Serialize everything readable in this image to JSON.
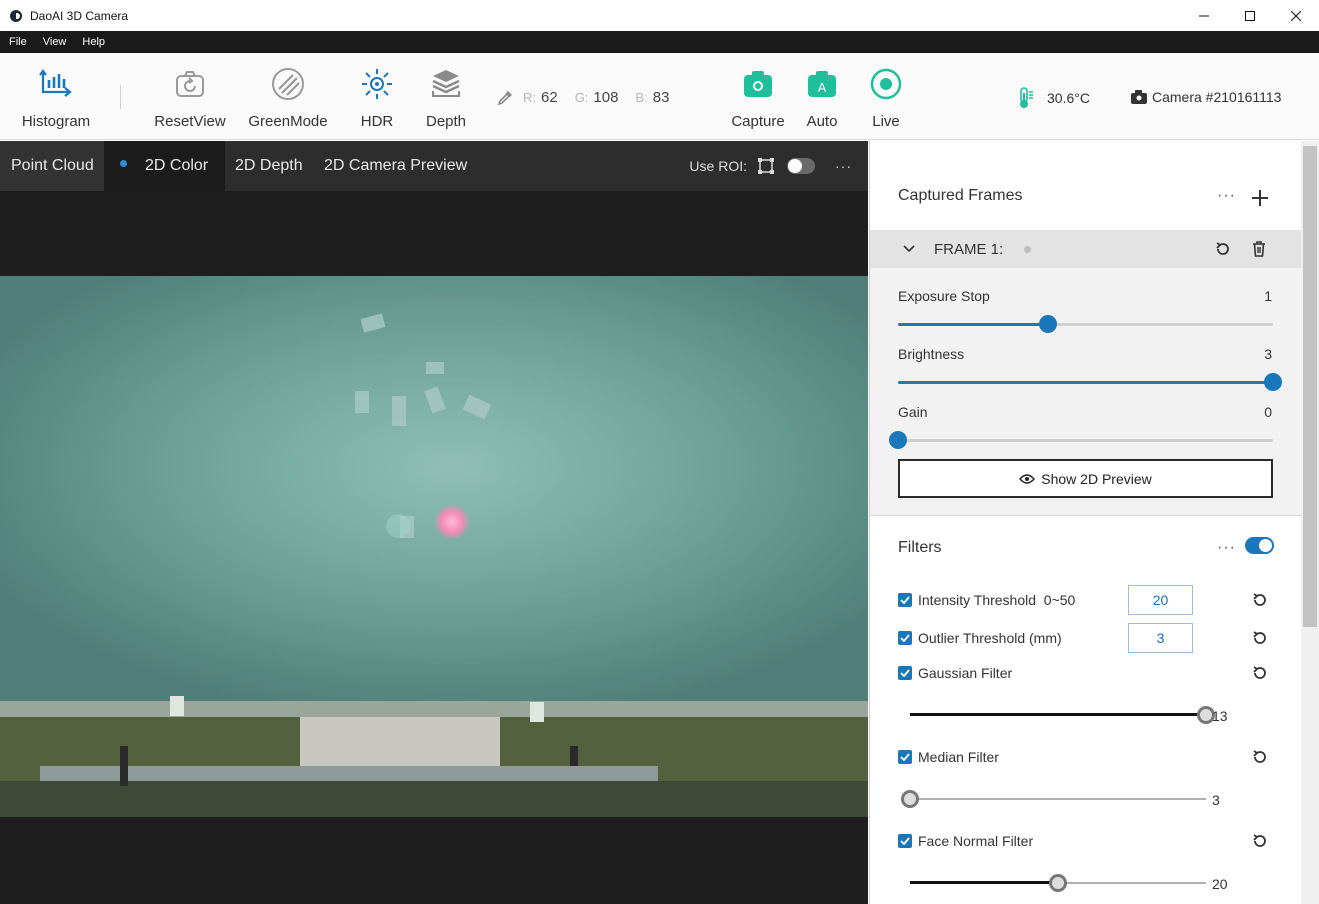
{
  "window": {
    "title": "DaoAI 3D Camera"
  },
  "menu": [
    "File",
    "View",
    "Help"
  ],
  "toolbar": {
    "histogram": "Histogram",
    "reset_view": "ResetView",
    "green_mode": "GreenMode",
    "hdr": "HDR",
    "depth": "Depth",
    "capture": "Capture",
    "auto": "Auto",
    "live": "Live",
    "rgb": {
      "r_label": "R:",
      "r": "62",
      "g_label": "G:",
      "g": "108",
      "b_label": "B:",
      "b": "83"
    },
    "temperature": "30.6°C",
    "camera": "Camera #210161113",
    "accent": "#1fbf9c"
  },
  "viewer": {
    "tabs": [
      "Point Cloud",
      "2D Color",
      "2D Depth",
      "2D Camera Preview"
    ],
    "active_tab": "2D Color",
    "roi_label": "Use ROI:"
  },
  "panel": {
    "captured_title": "Captured Frames",
    "frame_label": "FRAME 1:",
    "sliders": [
      {
        "label": "Exposure Stop",
        "value": "1",
        "fraction": 0.4
      },
      {
        "label": "Brightness",
        "value": "3",
        "fraction": 1.0
      },
      {
        "label": "Gain",
        "value": "0",
        "fraction": 0.0
      }
    ],
    "preview_button": "Show 2D Preview",
    "filters_title": "Filters",
    "filters": {
      "intensity": {
        "label": "Intensity Threshold  0~50",
        "value": "20"
      },
      "outlier": {
        "label": "Outlier Threshold (mm)",
        "value": "3"
      },
      "gaussian": {
        "label": "Gaussian Filter",
        "value": "13",
        "fraction": 1.0
      },
      "median": {
        "label": "Median Filter",
        "value": "3",
        "fraction": 0.0
      },
      "face_normal": {
        "label": "Face Normal Filter",
        "value": "20",
        "fraction": 0.5
      }
    }
  }
}
